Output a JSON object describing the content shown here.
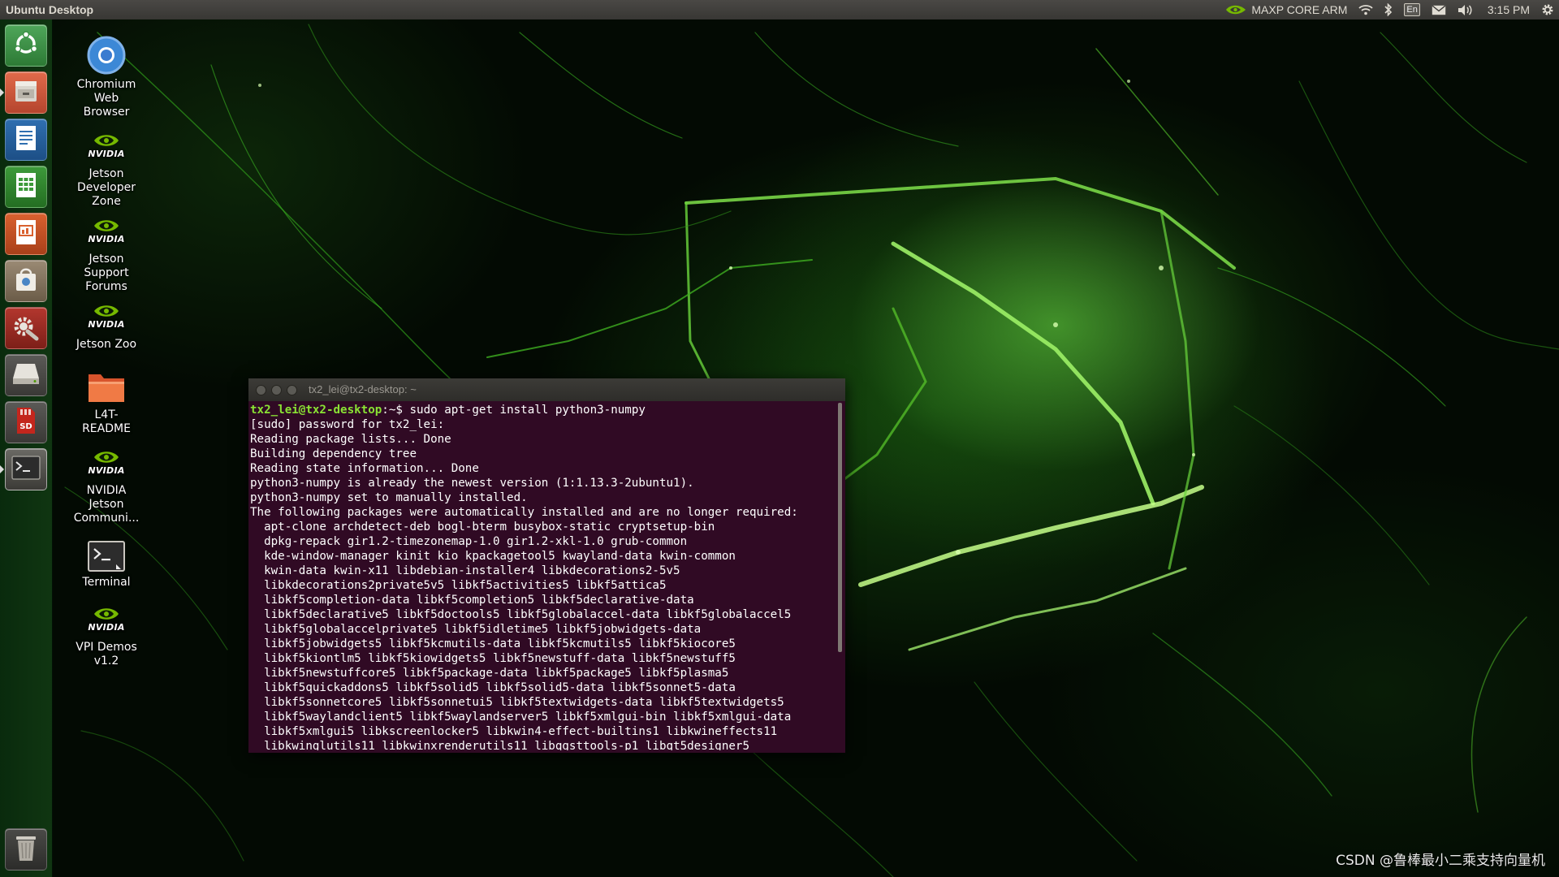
{
  "top_panel": {
    "title": "Ubuntu Desktop",
    "power_mode": "MAXP CORE ARM",
    "lang": "En",
    "clock": "3:15 PM"
  },
  "launcher": {
    "items": [
      {
        "name": "ubuntu-dash",
        "active": false
      },
      {
        "name": "files",
        "active": true
      },
      {
        "name": "libreoffice-writer",
        "active": false
      },
      {
        "name": "libreoffice-calc",
        "active": false
      },
      {
        "name": "libreoffice-impress",
        "active": false
      },
      {
        "name": "software-center",
        "active": false
      },
      {
        "name": "system-settings",
        "active": false
      },
      {
        "name": "drive",
        "active": false
      },
      {
        "name": "sd-card",
        "active": false
      },
      {
        "name": "terminal",
        "active": true
      },
      {
        "name": "trash",
        "active": false
      }
    ]
  },
  "desktop": {
    "nvidia_wordmark": "NVIDIA",
    "icons": [
      {
        "label_lines": [
          "Chromium",
          "Web",
          "Browser"
        ]
      },
      {
        "label_lines": [
          "Jetson",
          "Developer",
          "Zone"
        ]
      },
      {
        "label_lines": [
          "Jetson",
          "Support",
          "Forums"
        ]
      },
      {
        "label_lines": [
          "Jetson Zoo"
        ]
      },
      {
        "label_lines": [
          "L4T-",
          "README"
        ]
      },
      {
        "label_lines": [
          "NVIDIA",
          "Jetson",
          "Communi..."
        ]
      },
      {
        "label_lines": [
          "Terminal"
        ]
      },
      {
        "label_lines": [
          "VPI Demos",
          "v1.2"
        ]
      }
    ]
  },
  "terminal": {
    "title": "tx2_lei@tx2-desktop: ~",
    "prompt_user": "tx2_lei@tx2-desktop",
    "prompt_path": ":~",
    "prompt_symbol": "$ ",
    "command": "sudo apt-get install python3-numpy",
    "output_lines": [
      "[sudo] password for tx2_lei:",
      "Reading package lists... Done",
      "Building dependency tree",
      "Reading state information... Done",
      "python3-numpy is already the newest version (1:1.13.3-2ubuntu1).",
      "python3-numpy set to manually installed.",
      "The following packages were automatically installed and are no longer required:",
      "  apt-clone archdetect-deb bogl-bterm busybox-static cryptsetup-bin",
      "  dpkg-repack gir1.2-timezonemap-1.0 gir1.2-xkl-1.0 grub-common",
      "  kde-window-manager kinit kio kpackagetool5 kwayland-data kwin-common",
      "  kwin-data kwin-x11 libdebian-installer4 libkdecorations2-5v5",
      "  libkdecorations2private5v5 libkf5activities5 libkf5attica5",
      "  libkf5completion-data libkf5completion5 libkf5declarative-data",
      "  libkf5declarative5 libkf5doctools5 libkf5globalaccel-data libkf5globalaccel5",
      "  libkf5globalaccelprivate5 libkf5idletime5 libkf5jobwidgets-data",
      "  libkf5jobwidgets5 libkf5kcmutils-data libkf5kcmutils5 libkf5kiocore5",
      "  libkf5kiontlm5 libkf5kiowidgets5 libkf5newstuff-data libkf5newstuff5",
      "  libkf5newstuffcore5 libkf5package-data libkf5package5 libkf5plasma5",
      "  libkf5quickaddons5 libkf5solid5 libkf5solid5-data libkf5sonnet5-data",
      "  libkf5sonnetcore5 libkf5sonnetui5 libkf5textwidgets-data libkf5textwidgets5",
      "  libkf5waylandclient5 libkf5waylandserver5 libkf5xmlgui-bin libkf5xmlgui-data",
      "  libkf5xmlgui5 libkscreenlocker5 libkwin4-effect-builtins1 libkwineffects11",
      "  libkwinglutils11 libkwinxrenderutils11 libqgsttools-p1 libqt5designer5"
    ]
  },
  "watermark": "CSDN @鲁棒最小二乘支持向量机"
}
